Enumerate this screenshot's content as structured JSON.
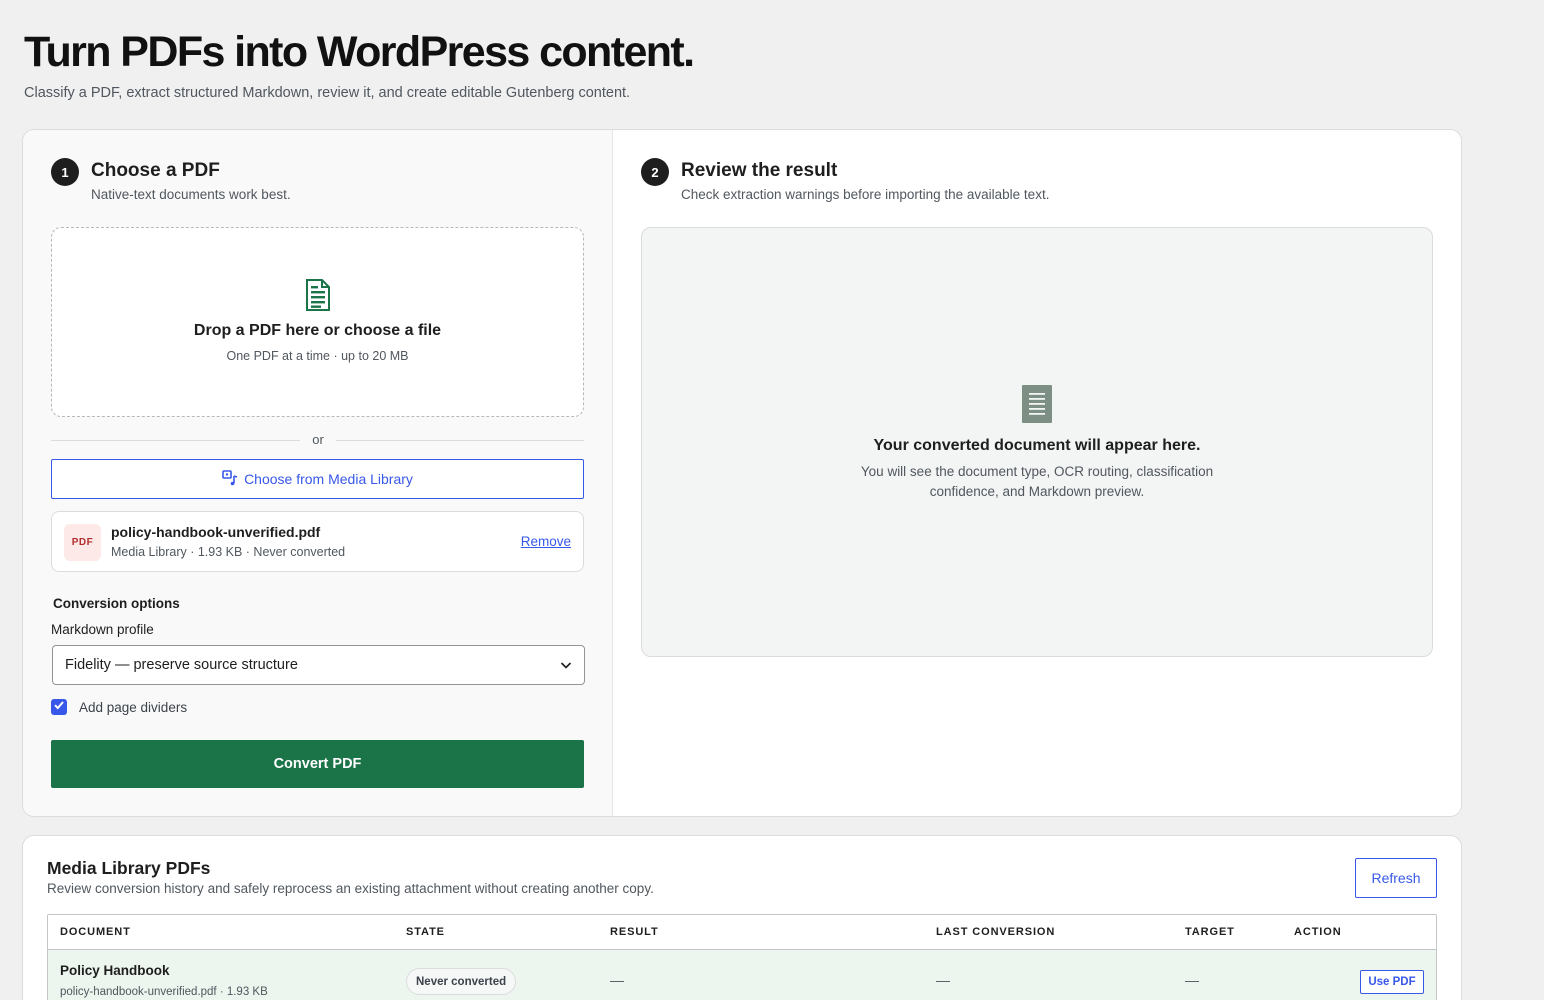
{
  "page": {
    "title": "Turn PDFs into WordPress content.",
    "subtitle": "Classify a PDF, extract structured Markdown, review it, and create editable Gutenberg content."
  },
  "step1": {
    "number": "1",
    "title": "Choose a PDF",
    "subtitle": "Native-text documents work best.",
    "dropzone": {
      "icon": "document-icon",
      "title": "Drop a PDF here or choose a file",
      "subtitle": "One PDF at a time · up to 20 MB"
    },
    "or_label": "or",
    "media_button_label": "Choose from Media Library",
    "selected_file": {
      "badge": "PDF",
      "name": "policy-handbook-unverified.pdf",
      "meta": "Media Library · 1.93 KB · Never converted",
      "remove_label": "Remove"
    },
    "options": {
      "heading": "Conversion options",
      "profile_label": "Markdown profile",
      "profile_value": "Fidelity — preserve source structure",
      "page_dividers_label": "Add page dividers",
      "page_dividers_checked": true
    },
    "convert_label": "Convert PDF"
  },
  "step2": {
    "number": "2",
    "title": "Review the result",
    "subtitle": "Check extraction warnings before importing the available text.",
    "empty": {
      "icon": "document-lines-icon",
      "title": "Your converted document will appear here.",
      "description": "You will see the document type, OCR routing, classification confidence, and Markdown preview."
    }
  },
  "library": {
    "title": "Media Library PDFs",
    "subtitle": "Review conversion history and safely reprocess an existing attachment without creating another copy.",
    "refresh_label": "Refresh",
    "columns": [
      "DOCUMENT",
      "STATE",
      "RESULT",
      "LAST CONVERSION",
      "TARGET",
      "ACTION"
    ],
    "rows": [
      {
        "name": "Policy Handbook",
        "meta": "policy-handbook-unverified.pdf · 1.93 KB",
        "state": "Never converted",
        "result": "—",
        "last_conversion": "—",
        "target": "—",
        "action": "Use PDF"
      }
    ]
  },
  "colors": {
    "primary_green": "#1b7348",
    "accent_blue": "#3858e9",
    "icon_green": "#1b7348",
    "icon_gray": "#7d8f84"
  }
}
